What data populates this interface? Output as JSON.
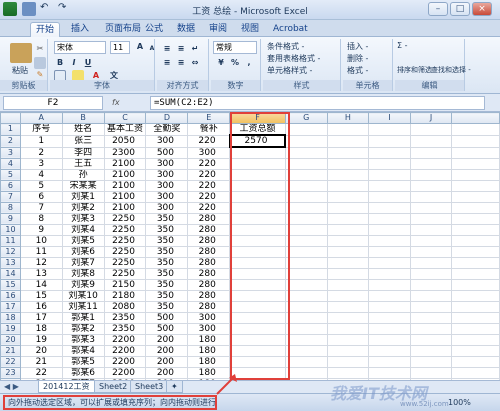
{
  "window": {
    "title": "工资 总绘 - Microsoft Excel"
  },
  "tabs": [
    "开始",
    "插入",
    "页面布局",
    "公式",
    "数据",
    "审阅",
    "视图",
    "Acrobat"
  ],
  "ribbon": {
    "clipboard": {
      "label": "剪贴板",
      "paste": "粘贴"
    },
    "font": {
      "label": "字体",
      "name": "宋体",
      "size": "11",
      "bold": "B",
      "italic": "I",
      "underline": "U",
      "grow": "A",
      "shrink": "A",
      "wen": "文"
    },
    "alignment": {
      "label": "对齐方式"
    },
    "number": {
      "label": "数字",
      "format": "常规",
      "pct": "%",
      "comma": ","
    },
    "styles": {
      "label": "样式",
      "cond": "条件格式 -",
      "table": "套用表格格式 -",
      "cell": "单元格样式 -"
    },
    "cells": {
      "label": "单元格",
      "insert": "插入 -",
      "delete": "删除 -",
      "format": "格式 -"
    },
    "editing": {
      "label": "编辑",
      "sum": "Σ -",
      "sort": "排序和筛选 -",
      "find": "查找和选择 -"
    }
  },
  "formula_bar": {
    "name_box": "F2",
    "fx": "fx",
    "formula": "=SUM(C2:E2)"
  },
  "grid": {
    "columns": [
      "A",
      "B",
      "C",
      "D",
      "E",
      "F",
      "G",
      "H",
      "I",
      "J"
    ],
    "rows": [
      [
        "1",
        "序号",
        "姓名",
        "基本工资",
        "全勤奖",
        "餐补",
        "工资总额"
      ],
      [
        "2",
        "1",
        "张三",
        "2050",
        "300",
        "220",
        "2570"
      ],
      [
        "3",
        "2",
        "李四",
        "2300",
        "500",
        "300",
        ""
      ],
      [
        "4",
        "3",
        "王五",
        "2100",
        "300",
        "220",
        ""
      ],
      [
        "5",
        "4",
        "孙",
        "2100",
        "300",
        "220",
        ""
      ],
      [
        "6",
        "5",
        "宋某某",
        "2100",
        "300",
        "220",
        ""
      ],
      [
        "7",
        "6",
        "刘某1",
        "2100",
        "300",
        "220",
        ""
      ],
      [
        "8",
        "7",
        "刘某2",
        "2100",
        "300",
        "220",
        ""
      ],
      [
        "9",
        "8",
        "刘某3",
        "2250",
        "350",
        "280",
        ""
      ],
      [
        "10",
        "9",
        "刘某4",
        "2250",
        "350",
        "280",
        ""
      ],
      [
        "11",
        "10",
        "刘某5",
        "2250",
        "350",
        "280",
        ""
      ],
      [
        "12",
        "11",
        "刘某6",
        "2250",
        "350",
        "280",
        ""
      ],
      [
        "13",
        "12",
        "刘某7",
        "2250",
        "350",
        "280",
        ""
      ],
      [
        "14",
        "13",
        "刘某8",
        "2250",
        "350",
        "280",
        ""
      ],
      [
        "15",
        "14",
        "刘某9",
        "2150",
        "350",
        "280",
        ""
      ],
      [
        "16",
        "15",
        "刘某10",
        "2180",
        "350",
        "280",
        ""
      ],
      [
        "17",
        "16",
        "刘某11",
        "2080",
        "350",
        "280",
        ""
      ],
      [
        "18",
        "17",
        "郭某1",
        "2350",
        "500",
        "300",
        ""
      ],
      [
        "19",
        "18",
        "郭某2",
        "2350",
        "500",
        "300",
        ""
      ],
      [
        "20",
        "19",
        "郭某3",
        "2200",
        "200",
        "180",
        ""
      ],
      [
        "21",
        "20",
        "郭某4",
        "2200",
        "200",
        "180",
        ""
      ],
      [
        "22",
        "21",
        "郭某5",
        "2200",
        "200",
        "180",
        ""
      ],
      [
        "23",
        "22",
        "郭某6",
        "2200",
        "200",
        "180",
        ""
      ],
      [
        "24",
        "23",
        "郭某7",
        "2200",
        "200",
        "180",
        ""
      ],
      [
        "25",
        "",
        "",
        "",
        "",
        "",
        ""
      ]
    ]
  },
  "sheet_tabs": [
    "201412工资",
    "Sheet2",
    "Sheet3"
  ],
  "status": {
    "message": "向外拖动选定区域，可以扩展或填充序列；向内拖动则进行清除",
    "zoom": "100%"
  },
  "watermark": {
    "text": "我爱IT技术网",
    "url": "www.52ij.com"
  },
  "colors": {
    "highlight": "#e0403a",
    "accent": "#15428b"
  }
}
